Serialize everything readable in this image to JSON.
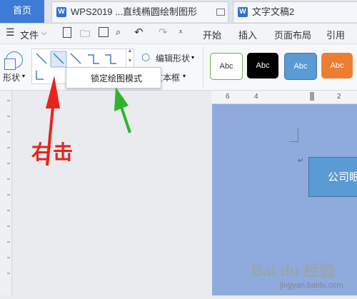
{
  "tabs": {
    "home": "首页",
    "doc1": "WPS2019 ...直线椭圆绘制图形",
    "doc2": "文字文稿2"
  },
  "menubar": {
    "file": "文件",
    "start": "开始",
    "insert": "插入",
    "layout": "页面布局",
    "reference": "引用"
  },
  "ribbon": {
    "shape_label": "形状",
    "edit_shape": "编辑形状",
    "textbox_partial": "文本框",
    "styles": [
      "Abc",
      "Abc",
      "Abc",
      "Abc"
    ],
    "style_colors": [
      "#ffffff",
      "#000000",
      "#5b9bd5",
      "#ed7d31"
    ]
  },
  "context_menu": {
    "lock_draw_mode": "锁定绘图模式"
  },
  "ruler": {
    "ticks": [
      "6",
      "4",
      "2"
    ]
  },
  "annotation": {
    "text": "右击",
    "red_arrow_color": "#e8231f",
    "green_arrow_color": "#2db52d"
  },
  "document": {
    "textbox_text": "公司眼",
    "para_mark": "↵"
  },
  "watermark": {
    "brand": "Bai du 经验",
    "url": "jingyan.baidu.com"
  }
}
